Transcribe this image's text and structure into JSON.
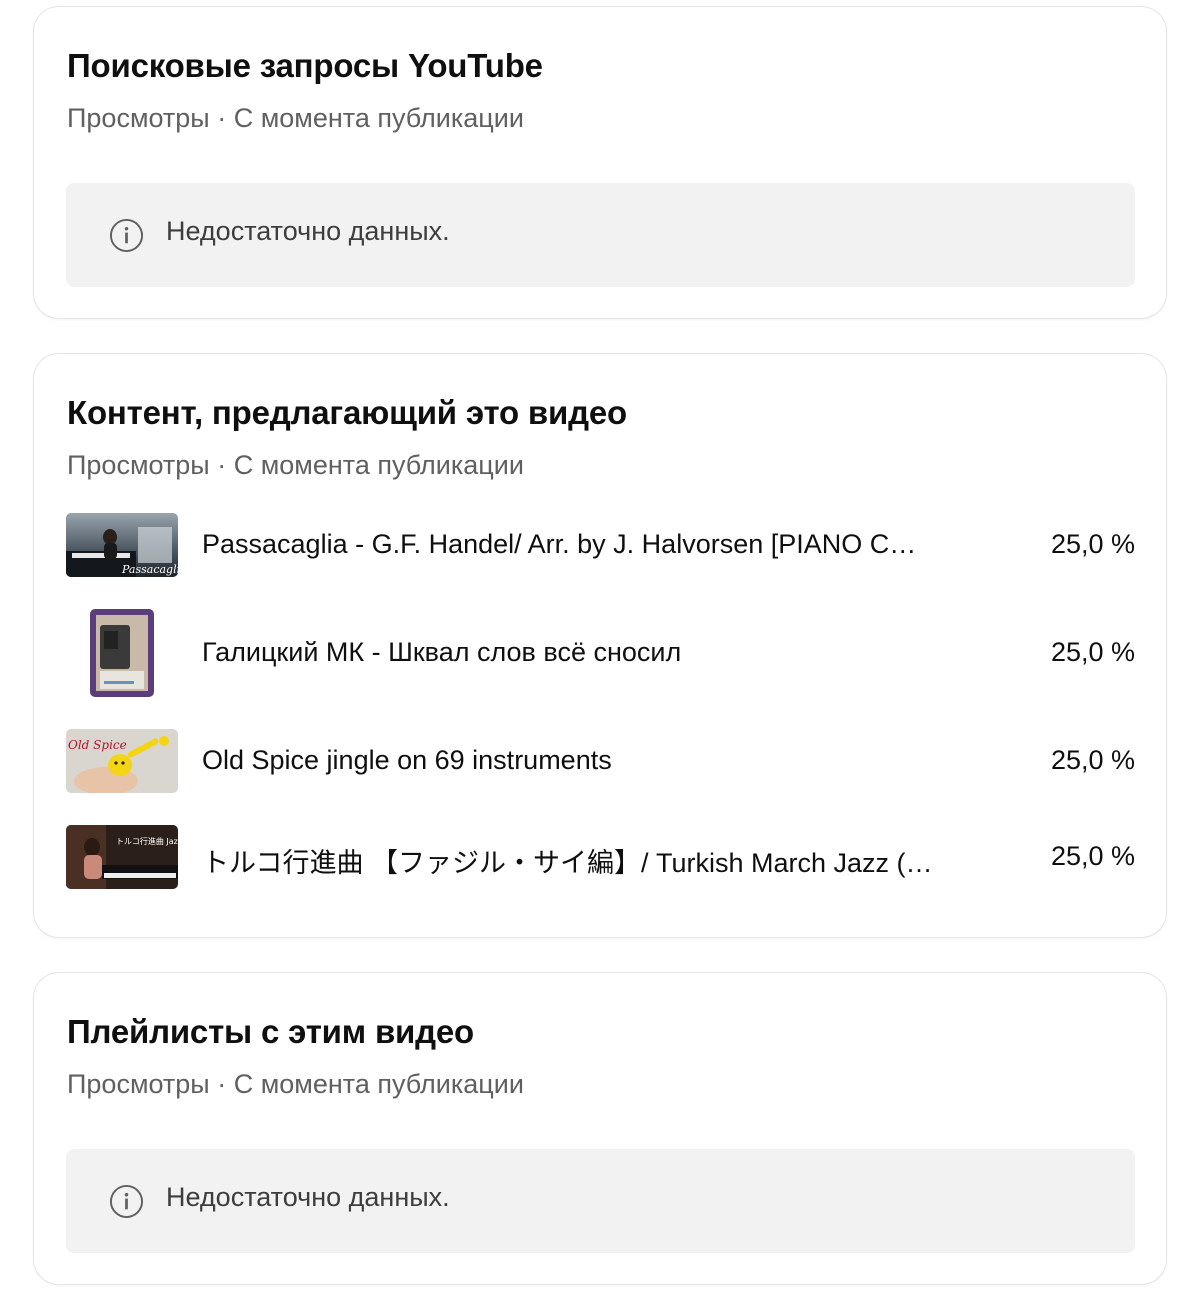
{
  "search_card": {
    "title": "Поисковые запросы YouTube",
    "subtitle": "Просмотры · С момента публикации",
    "no_data_text": "Недостаточно данных.",
    "icon": "info-icon"
  },
  "content_card": {
    "title": "Контент, предлагающий это видео",
    "subtitle": "Просмотры · С момента публикации",
    "items": [
      {
        "title": "Passacaglia - G.F. Handel/ Arr. by J. Halvorsen [PIANO COVER]",
        "value": "25,0 %",
        "thumb_text": "Passacaglia"
      },
      {
        "title": "Галицкий МК - Шквал слов всё сносил",
        "value": "25,0 %"
      },
      {
        "title": "Old Spice jingle on 69 instruments",
        "value": "25,0 %",
        "thumb_text": "Old Spice"
      },
      {
        "title": "トルコ行進曲 【ファジル・サイ編】/ Turkish March Jazz (Fazil Say)",
        "value": "25,0 %",
        "thumb_text": "トルコ行進曲 Jazz"
      }
    ]
  },
  "playlists_card": {
    "title": "Плейлисты с этим видео",
    "subtitle": "Просмотры · С момента публикации",
    "no_data_text": "Недостаточно данных.",
    "icon": "info-icon"
  },
  "colors": {
    "text_primary": "#0f0f0f",
    "text_secondary": "#606060",
    "no_data_bg": "#f2f2f2",
    "card_border": "#e6e6e6"
  }
}
